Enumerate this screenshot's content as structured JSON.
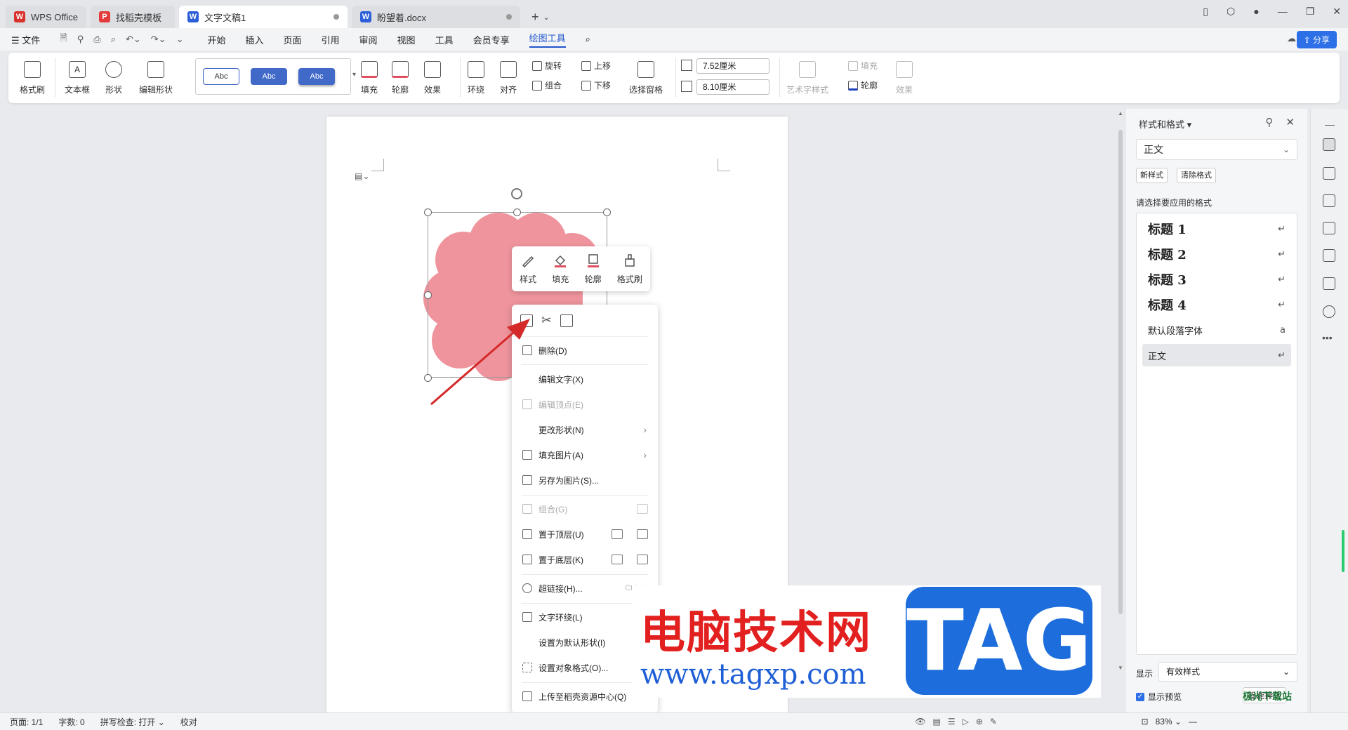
{
  "tabs": [
    {
      "label": "WPS Office",
      "icon": "W",
      "color": "#d9312b"
    },
    {
      "label": "找稻壳模板",
      "icon": "P",
      "color": "#e33b3b"
    },
    {
      "label": "文字文稿1",
      "icon": "W",
      "color": "#2c5fd8"
    },
    {
      "label": "盼望着.docx",
      "icon": "W",
      "color": "#2c5fd8"
    }
  ],
  "menu": {
    "file": "文件",
    "items": [
      "开始",
      "插入",
      "页面",
      "引用",
      "审阅",
      "视图",
      "工具",
      "会员专享",
      "绘图工具"
    ],
    "share": "分享"
  },
  "ribbon": {
    "format_painter": "格式刷",
    "textbox": "文本框",
    "shape": "形状",
    "edit_shape": "编辑形状",
    "style_samples": [
      "Abc",
      "Abc",
      "Abc"
    ],
    "fill": "填充",
    "outline": "轮廓",
    "effect": "效果",
    "wrap": "环绕",
    "align": "对齐",
    "rotate": "旋转",
    "group": "组合",
    "up": "上移",
    "down": "下移",
    "select_pane": "选择窗格",
    "width": "7.52厘米",
    "height": "8.10厘米",
    "art_style": "艺术字样式",
    "art_fill": "填充",
    "art_outline": "轮廓",
    "art_effect": "效果"
  },
  "mini_toolbar": [
    "样式",
    "填充",
    "轮廓",
    "格式刷"
  ],
  "context_menu": {
    "delete": "删除(D)",
    "edit_text": "编辑文字(X)",
    "edit_points": "编辑顶点(E)",
    "change_shape": "更改形状(N)",
    "fill_picture": "填充图片(A)",
    "save_as_picture": "另存为图片(S)...",
    "group": "组合(G)",
    "bring_front": "置于顶层(U)",
    "send_back": "置于底层(K)",
    "hyperlink": "超链接(H)...",
    "hyperlink_shortcut": "Ctrl+K",
    "text_wrap": "文字环绕(L)",
    "set_default": "设置为默认形状(I)",
    "format_object": "设置对象格式(O)...",
    "upload": "上传至稻壳资源中心(Q)"
  },
  "right_panel": {
    "title": "样式和格式",
    "current": "正文",
    "new_style": "新样式",
    "clear_format": "清除格式",
    "apply_label": "请选择要应用的格式",
    "styles": [
      "标题 1",
      "标题 2",
      "标题 3",
      "标题 4",
      "默认段落字体",
      "正文"
    ],
    "show_label": "显示",
    "show_value": "有效样式",
    "preview": "显示预览",
    "smart_layout": "智能排版"
  },
  "status": {
    "page": "页面: 1/1",
    "words": "字数: 0",
    "spell": "拼写检查: 打开",
    "proof": "校对",
    "zoom": "83%"
  },
  "watermark": {
    "title": "电脑技术网",
    "url": "www.tagxp.com",
    "tag": "TAG",
    "site2": "极光下载站"
  },
  "colors": {
    "shape_fill": "#ef949d",
    "accent": "#2c6fe6",
    "arrow": "#d42a2a"
  }
}
